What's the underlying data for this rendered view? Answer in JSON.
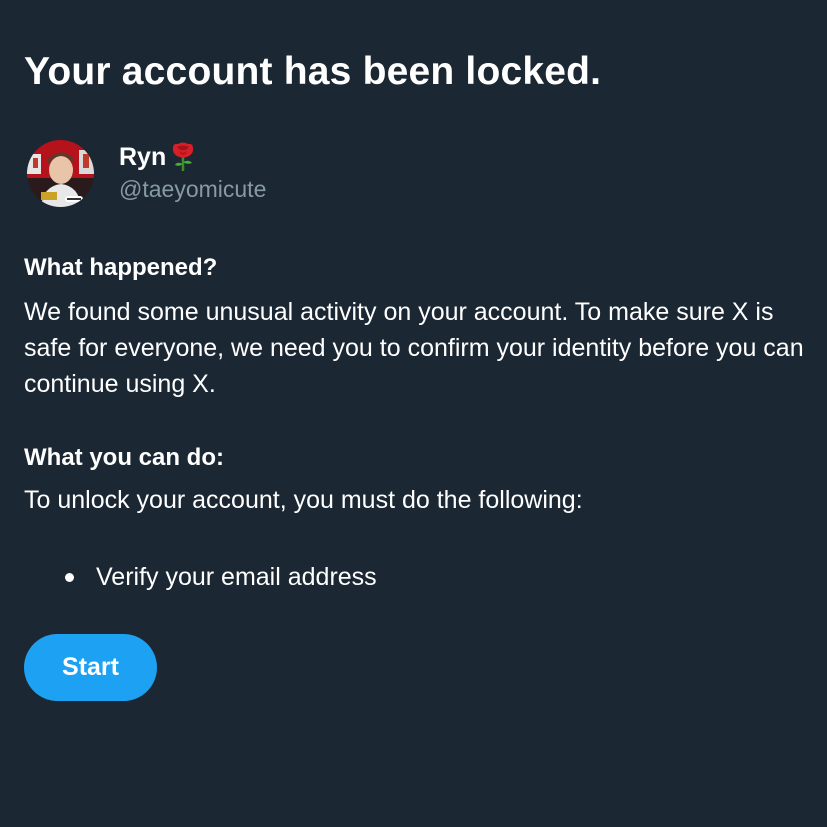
{
  "page": {
    "title": "Your account has been locked."
  },
  "profile": {
    "display_name": "Ryn",
    "emoji": "🌹",
    "handle": "@taeyomicute",
    "avatar_icon": "user-avatar"
  },
  "what_happened": {
    "heading": "What happened?",
    "body": "We found some unusual activity on your account. To make sure X is safe for everyone, we need you to confirm your identity before you can continue using X."
  },
  "what_you_can_do": {
    "heading": "What you can do:",
    "body": "To unlock your account, you must do the following:",
    "steps": [
      "Verify your email address"
    ]
  },
  "actions": {
    "start_label": "Start"
  },
  "colors": {
    "background": "#1b2733",
    "text": "#ffffff",
    "muted": "#8899a6",
    "accent": "#1da1f2"
  }
}
